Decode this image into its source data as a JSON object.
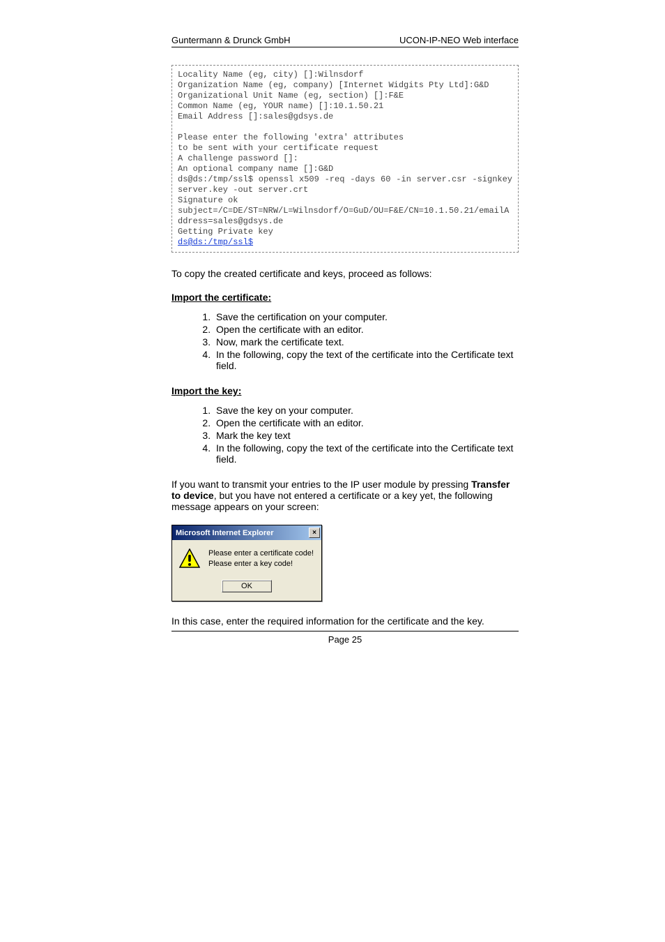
{
  "header": {
    "left": "Guntermann & Drunck GmbH",
    "right": "UCON-IP-NEO Web interface"
  },
  "terminal": {
    "lines": [
      "Locality Name (eg, city) []:Wilnsdorf",
      "Organization Name (eg, company) [Internet Widgits Pty Ltd]:G&D",
      "Organizational Unit Name (eg, section) []:F&E",
      "Common Name (eg, YOUR name) []:10.1.50.21",
      "Email Address []:sales@gdsys.de",
      "",
      "Please enter the following 'extra' attributes",
      "to be sent with your certificate request",
      "A challenge password []:",
      "An optional company name []:G&D",
      "ds@ds:/tmp/ssl$ openssl x509 -req -days 60 -in server.csr -signkey server.key -out server.crt",
      "Signature ok",
      "subject=/C=DE/ST=NRW/L=Wilnsdorf/O=GuD/OU=F&E/CN=10.1.50.21/emailAddress=sales@gdsys.de",
      "Getting Private key"
    ],
    "final_prompt": "ds@ds:/tmp/ssl$"
  },
  "body": {
    "intro_copy": "To copy the created certificate and keys, proceed as follows:",
    "import_cert_heading": "Import the certificate:",
    "import_cert_steps": [
      "Save the certification on your computer.",
      "Open the certificate with an editor.",
      "Now, mark the certificate text.",
      "In the following, copy the text of the certificate into the Certificate text field."
    ],
    "import_key_heading": "Import the key:",
    "import_key_steps": [
      "Save the key on your computer.",
      "Open the certificate with an editor.",
      "Mark the key text",
      "In the following, copy the text of the certificate into the Certificate text field."
    ],
    "transfer_prefix": "If you want to transmit your entries to the IP user module by pressing ",
    "transfer_bold": "Transfer to device",
    "transfer_suffix": ", but you have not entered a certificate or a key yet, the following message appears on your screen:",
    "closing": "In this case, enter the required information for the certificate and the key."
  },
  "dialog": {
    "title": "Microsoft Internet Explorer",
    "line1": "Please enter a certificate code!",
    "line2": "Please enter a key code!",
    "ok": "OK"
  },
  "footer": {
    "page": "Page 25"
  }
}
